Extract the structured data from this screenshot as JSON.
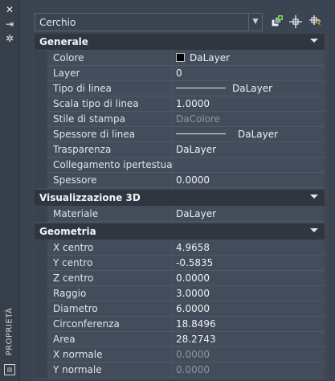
{
  "sidebar": {
    "close": "✕",
    "pin": "⇥",
    "settings": "✲",
    "title": "PROPRIETÀ"
  },
  "selector": {
    "value": "Cerchio"
  },
  "sections": {
    "generale": {
      "title": "Generale"
    },
    "vis3d": {
      "title": "Visualizzazione 3D"
    },
    "geometria": {
      "title": "Geometria"
    }
  },
  "generale": [
    {
      "label": "Colore",
      "value": "DaLayer"
    },
    {
      "label": "Layer",
      "value": "0"
    },
    {
      "label": "Tipo di linea",
      "value": "DaLayer"
    },
    {
      "label": "Scala tipo di linea",
      "value": "1.0000"
    },
    {
      "label": "Stile di stampa",
      "value": "DaColore"
    },
    {
      "label": "Spessore di linea",
      "value": "DaLayer"
    },
    {
      "label": "Trasparenza",
      "value": "DaLayer"
    },
    {
      "label": "Collegamento ipertestuale",
      "value": ""
    },
    {
      "label": "Spessore",
      "value": "0.0000"
    }
  ],
  "vis3d": [
    {
      "label": "Materiale",
      "value": "DaLayer"
    }
  ],
  "geometria": [
    {
      "label": "X centro",
      "value": "4.9658"
    },
    {
      "label": "Y centro",
      "value": "-0.5835"
    },
    {
      "label": "Z centro",
      "value": "0.0000"
    },
    {
      "label": "Raggio",
      "value": "3.0000"
    },
    {
      "label": "Diametro",
      "value": "6.0000"
    },
    {
      "label": "Circonferenza",
      "value": "18.8496"
    },
    {
      "label": "Area",
      "value": "28.2743"
    },
    {
      "label": "X normale",
      "value": "0.0000"
    },
    {
      "label": "Y normale",
      "value": "0.0000"
    }
  ],
  "colors": {
    "accent_quick_select": "#7ed957",
    "gold_icon": "#f0c419"
  }
}
